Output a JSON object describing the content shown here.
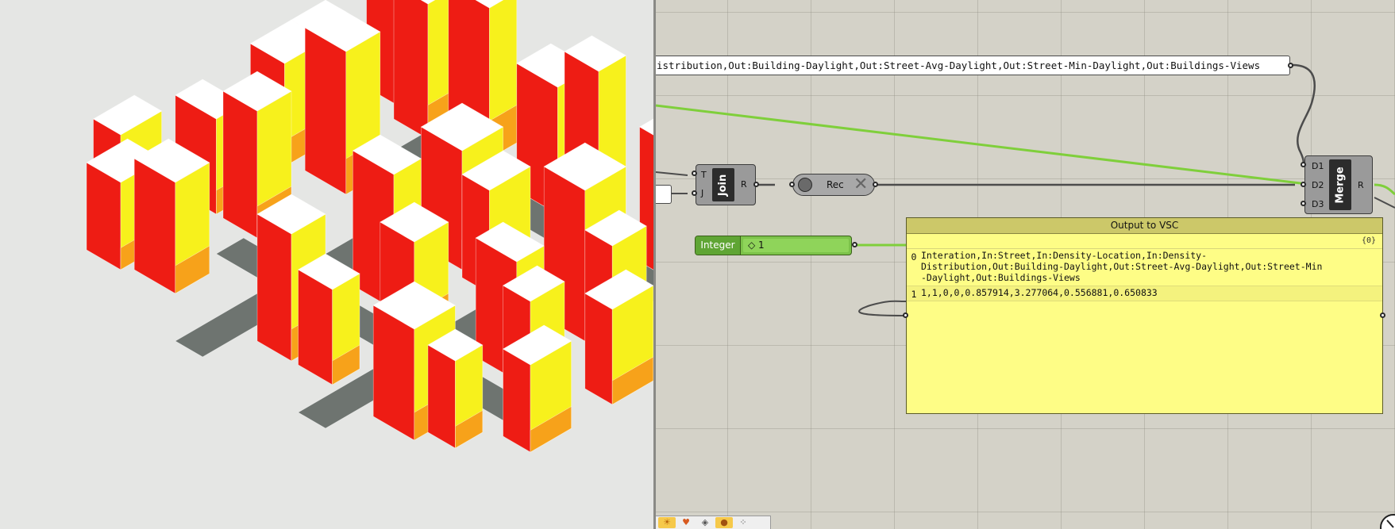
{
  "canvas": {
    "top_panel_text": "istribution,Out:Building-Daylight,Out:Street-Avg-Daylight,Out:Street-Min-Daylight,Out:Buildings-Views",
    "join": {
      "name": "Join",
      "in1": "T",
      "in2": "J",
      "out": "R"
    },
    "rec": {
      "label": "Rec"
    },
    "merge": {
      "name": "Merge",
      "in1": "D1",
      "in2": "D2",
      "in3": "D3",
      "out": "R"
    },
    "slider": {
      "name": "Integer",
      "value": "◇ 1"
    },
    "vsc_panel": {
      "title": "Output to VSC",
      "path": "{0}",
      "rows": [
        {
          "index": "0",
          "text": "Interation,In:Street,In:Density-Location,In:Density-\nDistribution,Out:Building-Daylight,Out:Street-Avg-Daylight,Out:Street-Min\n-Daylight,Out:Buildings-Views"
        },
        {
          "index": "1",
          "text": "1,1,0,0,0.857914,3.277064,0.556881,0.650833"
        }
      ]
    }
  },
  "toolbar": {
    "icons": [
      "sun-icon",
      "heart-icon",
      "layers-icon",
      "person-icon",
      "grid-dots-icon"
    ]
  },
  "colors": {
    "canvas_bg": "#d4d2c8",
    "viewport_bg": "#e5e6e4",
    "building_red": "#ee1c14",
    "building_yellow": "#f7f11c",
    "building_orange": "#f7a21a",
    "wire_green": "#7fcf3b",
    "panel_yellow": "#fefd86"
  }
}
